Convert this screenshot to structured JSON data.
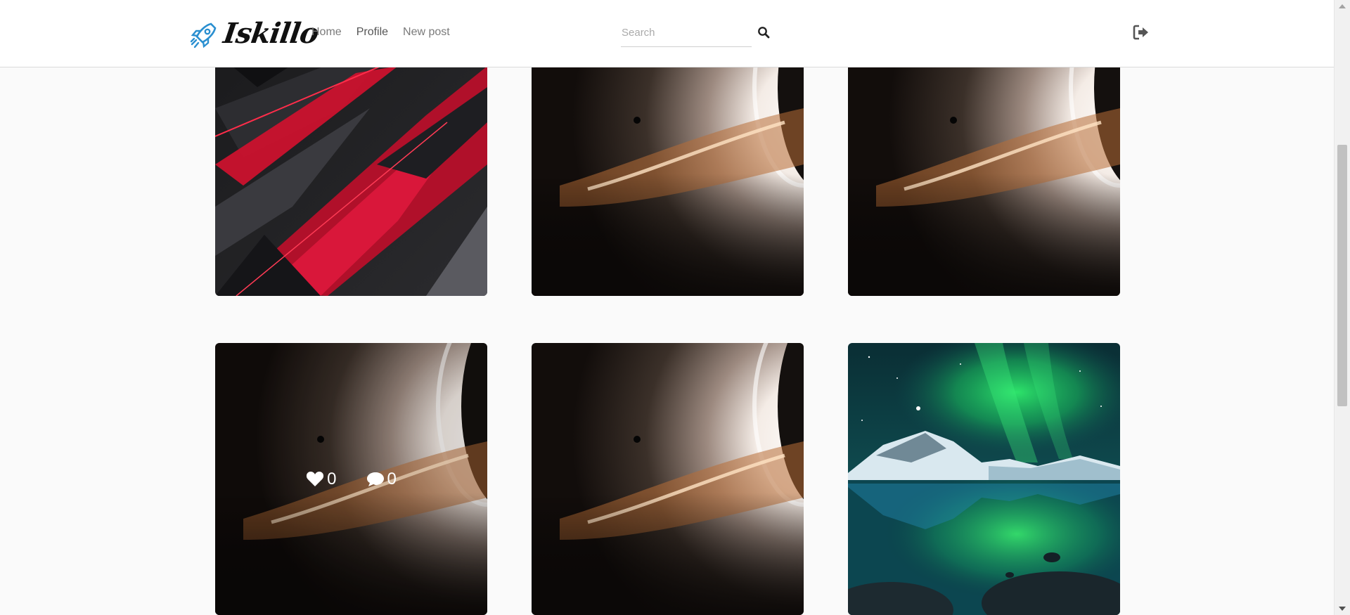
{
  "header": {
    "logo_text": "Iskillo",
    "nav": {
      "home": "Home",
      "profile": "Profile",
      "new_post": "New post"
    },
    "search": {
      "placeholder": "Search"
    }
  },
  "posts": [
    {
      "image": "red-abstract-shards",
      "likes": "",
      "comments": ""
    },
    {
      "image": "black-hole-gargantua",
      "likes": "",
      "comments": ""
    },
    {
      "image": "black-hole-gargantua",
      "likes": "",
      "comments": ""
    },
    {
      "image": "black-hole-gargantua",
      "likes": "0",
      "comments": "0",
      "hovered": true
    },
    {
      "image": "black-hole-gargantua",
      "likes": "",
      "comments": ""
    },
    {
      "image": "aurora-mountain-lake",
      "likes": "",
      "comments": ""
    }
  ],
  "colors": {
    "accent_blue": "#2a8fd0",
    "header_bg": "#ffffff",
    "page_bg": "#fafafa"
  }
}
